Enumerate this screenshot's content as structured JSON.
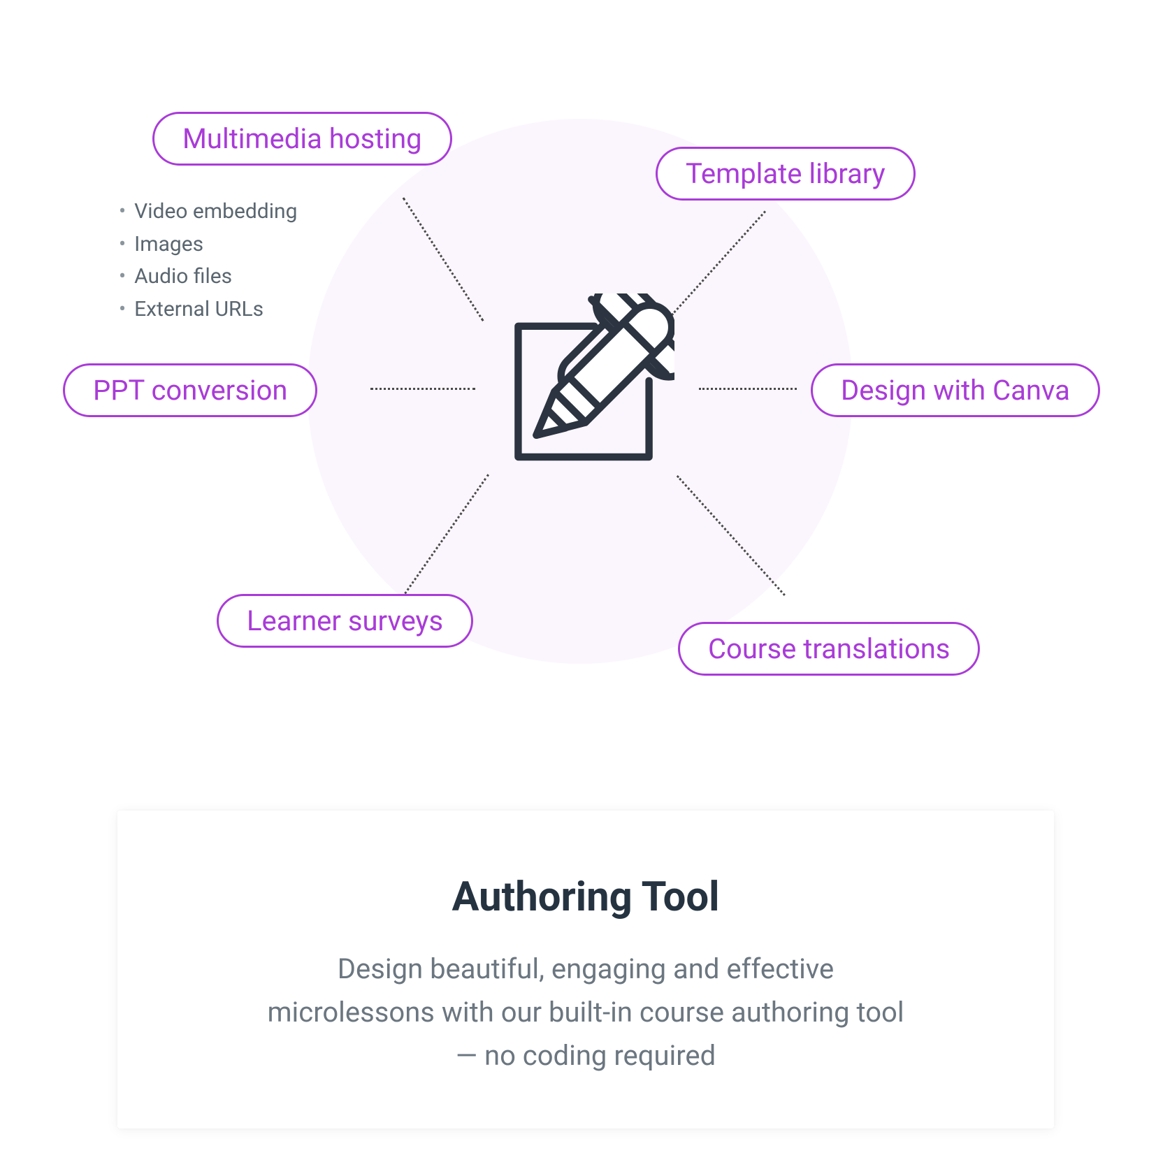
{
  "diagram": {
    "center_icon": "pencil-square-icon",
    "nodes": {
      "multimedia": {
        "label": "Multimedia hosting",
        "bullets": [
          "Video embedding",
          "Images",
          "Audio files",
          "External URLs"
        ]
      },
      "template": {
        "label": "Template library"
      },
      "ppt": {
        "label": "PPT conversion"
      },
      "canva": {
        "label": "Design with Canva"
      },
      "surveys": {
        "label": "Learner surveys"
      },
      "translations": {
        "label": "Course translations"
      }
    }
  },
  "card": {
    "title": "Authoring Tool",
    "description": "Design beautiful, engaging and effective microlessons with our built-in course authoring tool — no coding required"
  },
  "colors": {
    "accent": "#a93bd8",
    "text_dark": "#253341",
    "text_muted": "#6b7680"
  }
}
